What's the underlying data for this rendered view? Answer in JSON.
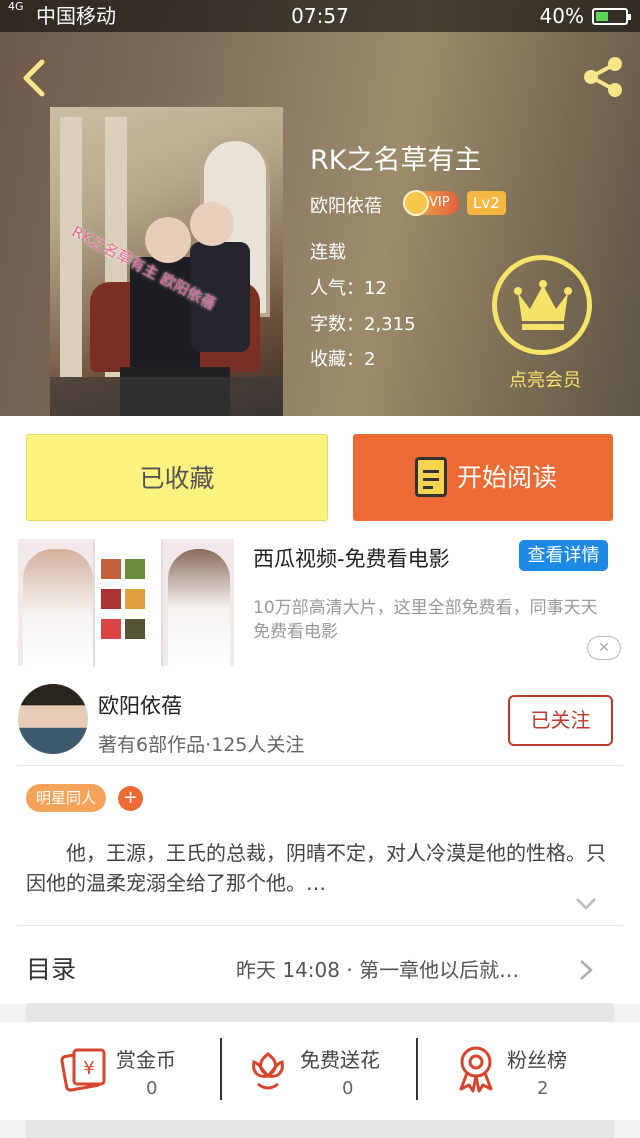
{
  "status_bar": {
    "signal": "4G",
    "carrier": "中国移动",
    "time": "07:57",
    "battery": "40%"
  },
  "book": {
    "title": "RK之名草有主",
    "author": "欧阳依蓓",
    "vip_label": "VIP",
    "level": "Lv2",
    "status": "连载",
    "popularity": "人气：12",
    "word_count": "字数：2,315",
    "favorites": "收藏：2",
    "cover_watermark": "RK之名草有主 欧阳依蓓"
  },
  "member": {
    "label": "点亮会员"
  },
  "actions": {
    "favorited_label": "已收藏",
    "read_label": "开始阅读"
  },
  "ad": {
    "title": "西瓜视频-免费看电影",
    "button": "查看详情",
    "description": "10万部高清大片，这里全部免费看，同事天天免费看电影",
    "close": "✕"
  },
  "author_card": {
    "name": "欧阳依蓓",
    "stats": "著有6部作品·125人关注",
    "follow_label": "已关注"
  },
  "tags": {
    "items": [
      "明星同人"
    ],
    "add": "+"
  },
  "description": "他，王源，王氏的总裁，阴晴不定，对人冷漠是他的性格。只因他的温柔宠溺全给了那个他。…",
  "toc": {
    "label": "目录",
    "latest": "昨天 14:08 · 第一章他以后就…"
  },
  "support": [
    {
      "label": "赏金币",
      "count": "0",
      "icon": "gold-coin-icon"
    },
    {
      "label": "免费送花",
      "count": "0",
      "icon": "flower-icon"
    },
    {
      "label": "粉丝榜",
      "count": "2",
      "icon": "award-ribbon-icon"
    }
  ],
  "colors": {
    "accent_orange": "#ee6a35",
    "favorite_yellow": "#fbf27f",
    "member_gold": "#f6e36a",
    "follow_red": "#c0392b",
    "ad_blue": "#1e88e5"
  }
}
